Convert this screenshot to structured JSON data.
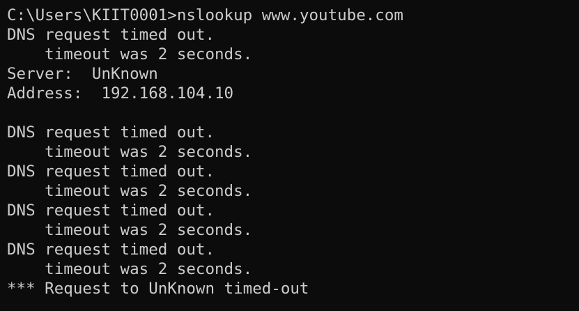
{
  "terminal": {
    "background_color": "#0c0c0c",
    "text_color": "#cccccc",
    "lines": [
      "C:\\Users\\KIIT0001>nslookup www.youtube.com",
      "DNS request timed out.",
      "    timeout was 2 seconds.",
      "Server:  UnKnown",
      "Address:  192.168.104.10",
      "",
      "DNS request timed out.",
      "    timeout was 2 seconds.",
      "DNS request timed out.",
      "    timeout was 2 seconds.",
      "DNS request timed out.",
      "    timeout was 2 seconds.",
      "DNS request timed out.",
      "    timeout was 2 seconds.",
      "*** Request to UnKnown timed-out"
    ]
  }
}
